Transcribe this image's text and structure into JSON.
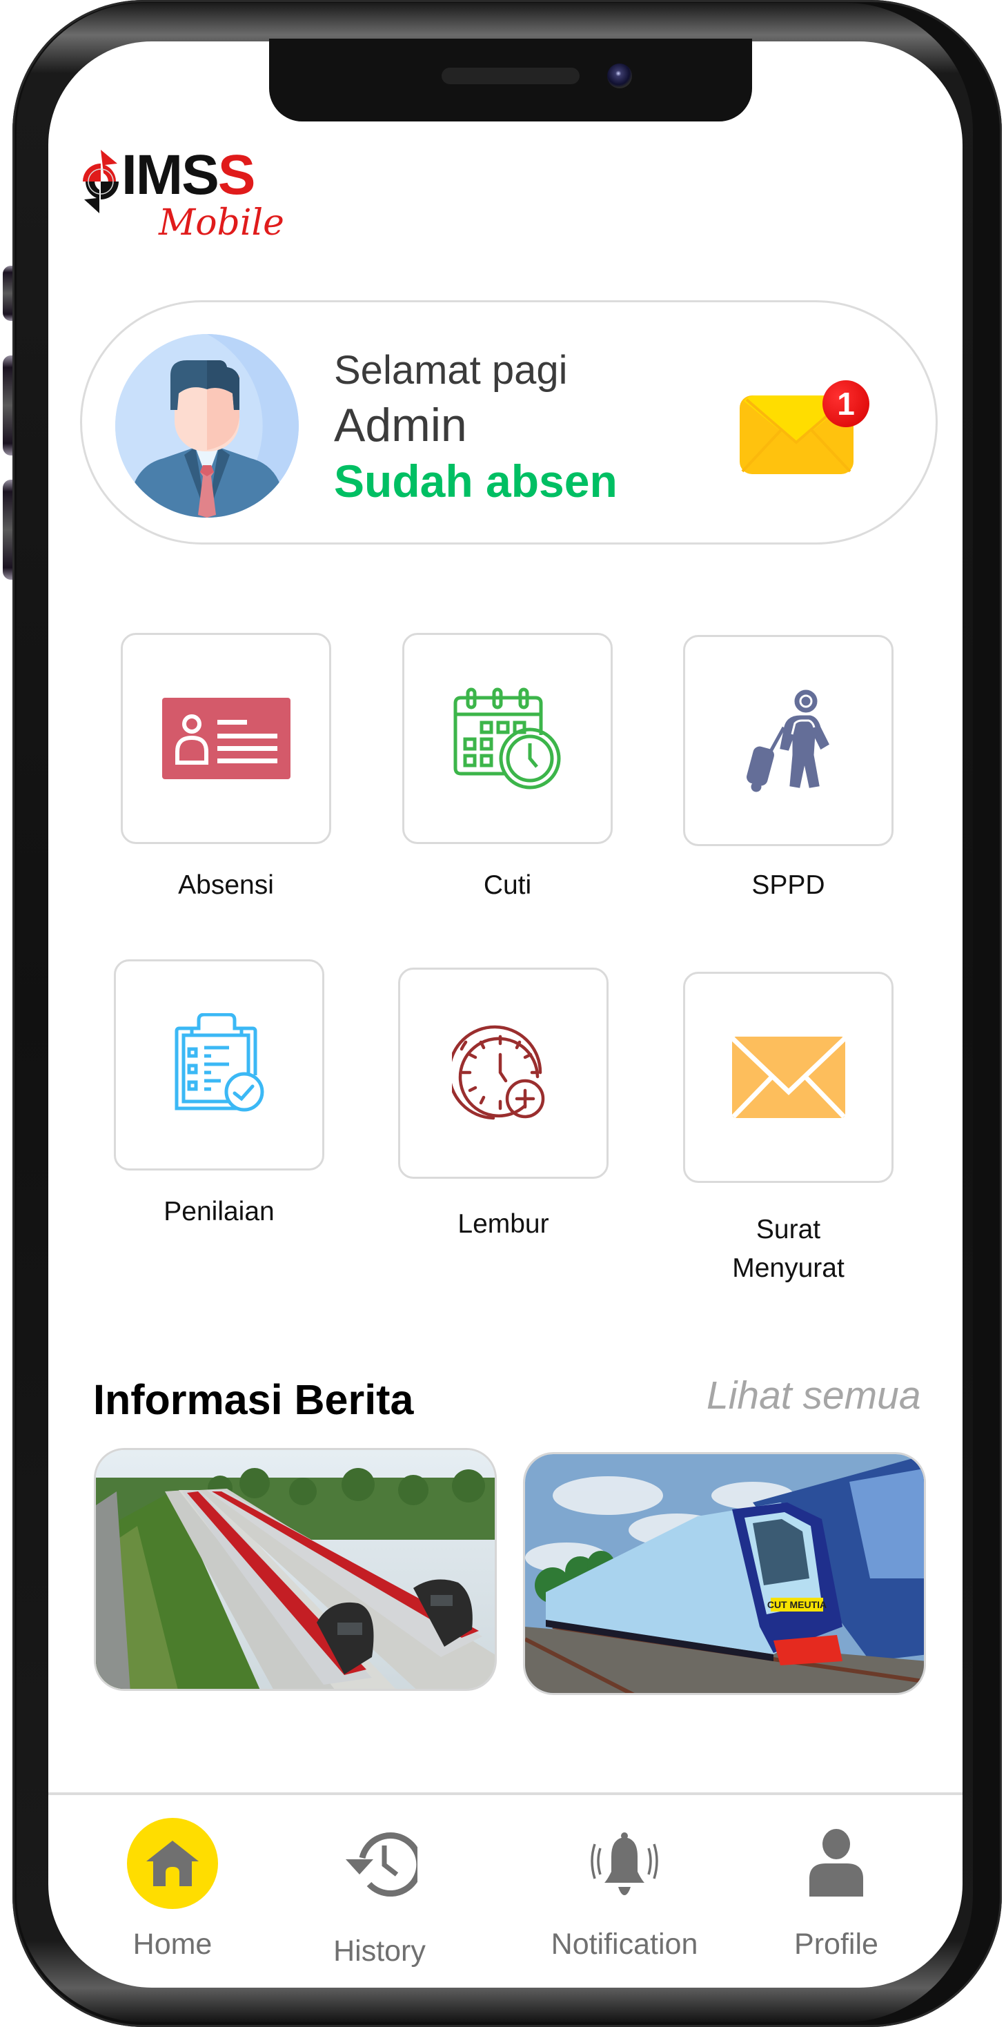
{
  "app": {
    "logo_main": "IMS",
    "logo_accent": "S",
    "logo_sub": "Mobile"
  },
  "greeting": {
    "salutation": "Selamat pagi",
    "user_name": "Admin",
    "attendance_status": "Sudah absen",
    "status_color": "#00bf63",
    "unread_messages": "1"
  },
  "menu": {
    "items": [
      {
        "label": "Absensi",
        "icon": "id-card-icon",
        "color": "#d45a6a"
      },
      {
        "label": "Cuti",
        "icon": "calendar-clock-icon",
        "color": "#3cb54a"
      },
      {
        "label": "SPPD",
        "icon": "traveler-luggage-icon",
        "color": "#646e98"
      },
      {
        "label": "Penilaian",
        "icon": "clipboard-check-icon",
        "color": "#3bb8f5"
      },
      {
        "label": "Lembur",
        "icon": "clock-plus-icon",
        "color": "#9a2e2e"
      },
      {
        "label": "Surat",
        "label_line2": "Menyurat",
        "icon": "envelope-icon",
        "color": "#fdbe5c"
      }
    ]
  },
  "news": {
    "title": "Informasi Berita",
    "see_all": "Lihat semua",
    "items": [
      {
        "image": "lrt-trains-photo",
        "sign_text": ""
      },
      {
        "image": "cut-meutia-train-photo",
        "sign_text": "CUT MEUTIA"
      }
    ]
  },
  "nav": {
    "active_color": "#ffdd00",
    "items": [
      {
        "label": "Home",
        "icon": "home-icon",
        "active": true
      },
      {
        "label": "History",
        "icon": "history-icon",
        "active": false
      },
      {
        "label": "Notification",
        "icon": "bell-ringing-icon",
        "active": false
      },
      {
        "label": "Profile",
        "icon": "user-icon",
        "active": false
      }
    ]
  }
}
